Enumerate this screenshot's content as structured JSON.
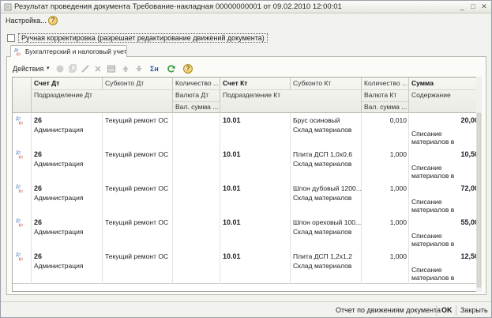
{
  "window": {
    "title": "Результат проведения документа Требование-накладная 00000000001 от 09.02.2010 12:00:01",
    "minimize_glyph": "_",
    "maximize_glyph": "□",
    "close_glyph": "✕"
  },
  "menu": {
    "settings_label": "Настройка...",
    "help_glyph": "?"
  },
  "manual_adjust": {
    "label": "Ручная корректировка (разрешает редактирование движений документа)",
    "checked": false
  },
  "tabs": [
    {
      "label": "Бухгалтерский и налоговый учет",
      "icon": "dt-kt-icon"
    }
  ],
  "toolbar": {
    "actions_label": "Действия",
    "actions_arrow": "▾",
    "icons": [
      "add-icon",
      "copy-icon",
      "edit-icon",
      "delete-icon",
      "table-icon",
      "move-up-icon",
      "move-down-icon",
      "sum-icon",
      "refresh-icon",
      "help-icon"
    ],
    "sum_label": "Σн",
    "help_glyph": "?"
  },
  "columns": {
    "row1": [
      "Счет Дт",
      "Субконто Дт",
      "Количество ...",
      "Счет Кт",
      "Субконто Кт",
      "Количество ...",
      "Сумма"
    ],
    "row2": [
      "Подразделение Дт",
      "Валюта Дт",
      "Подразделение Кт",
      "Валюта Кт",
      "Содержание"
    ],
    "row3": [
      "Вал. сумма ...",
      "Вал. сумма ..."
    ]
  },
  "entries": [
    {
      "account_dt": "26",
      "subconto_dt": "Текущий ремонт ОС",
      "department_dt": "Администрация",
      "account_kt": "10.01",
      "subconto_kt_1": "Брус осиновый",
      "subconto_kt_2": "Склад материалов",
      "quantity_kt": "0,010",
      "amount": "20,00",
      "content_1": "Списание",
      "content_2": "материалов в"
    },
    {
      "account_dt": "26",
      "subconto_dt": "Текущий ремонт ОС",
      "department_dt": "Администрация",
      "account_kt": "10.01",
      "subconto_kt_1": "Плита ДСП 1,0х0,6",
      "subconto_kt_2": "Склад материалов",
      "quantity_kt": "1,000",
      "amount": "10,50",
      "content_1": "Списание",
      "content_2": "материалов в"
    },
    {
      "account_dt": "26",
      "subconto_dt": "Текущий ремонт ОС",
      "department_dt": "Администрация",
      "account_kt": "10.01",
      "subconto_kt_1": "Шпон дубовый 1200...",
      "subconto_kt_2": "Склад материалов",
      "quantity_kt": "1,000",
      "amount": "72,00",
      "content_1": "Списание",
      "content_2": "материалов в"
    },
    {
      "account_dt": "26",
      "subconto_dt": "Текущий ремонт ОС",
      "department_dt": "Администрация",
      "account_kt": "10.01",
      "subconto_kt_1": "Шпон ореховый 100...",
      "subconto_kt_2": "Склад материалов",
      "quantity_kt": "1,000",
      "amount": "55,00",
      "content_1": "Списание",
      "content_2": "материалов в"
    },
    {
      "account_dt": "26",
      "subconto_dt": "Текущий ремонт ОС",
      "department_dt": "Администрация",
      "account_kt": "10.01",
      "subconto_kt_1": "Плита ДСП 1,2х1,2",
      "subconto_kt_2": "Склад материалов",
      "quantity_kt": "1,000",
      "amount": "12,50",
      "content_1": "Списание",
      "content_2": "материалов в"
    }
  ],
  "footer": {
    "report_label": "Отчет по движениям документа",
    "ok_label": "OK",
    "close_label": "Закрыть"
  },
  "colors": {
    "dt_icon": "#3a6fb5",
    "kt_icon": "#c23b2a",
    "help": "#e2b33c",
    "refresh": "#2e9b3a",
    "sum": "#2a56a8"
  }
}
